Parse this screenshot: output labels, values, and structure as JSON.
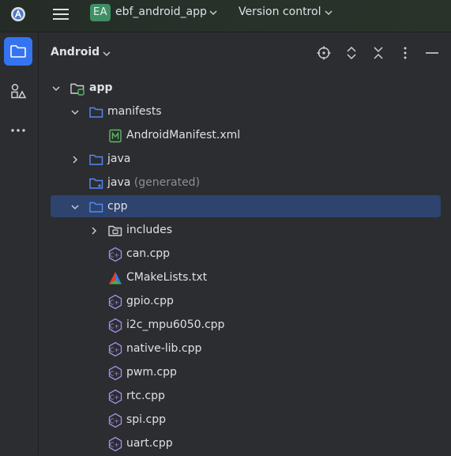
{
  "topbar": {
    "project_initials": "EA",
    "project_name": "ebf_android_app",
    "vcs_label": "Version control",
    "brand_color": "#3f8f64"
  },
  "sidebar": {
    "items": [
      {
        "icon": "folder-icon",
        "active": true
      },
      {
        "icon": "shapes-icon",
        "active": false
      },
      {
        "icon": "more-icon",
        "active": false
      }
    ],
    "active_color": "#3574f0"
  },
  "panel": {
    "title": "Android",
    "actions": [
      "locate-icon",
      "expand-all-icon",
      "collapse-all-icon",
      "options-icon",
      "minimize-icon"
    ]
  },
  "tree": {
    "selection_color": "#2e436e",
    "nodes": [
      {
        "label": "app",
        "depth": 0,
        "arrow": "down",
        "icon": "module-folder",
        "bold": true
      },
      {
        "label": "manifests",
        "depth": 1,
        "arrow": "down",
        "icon": "folder"
      },
      {
        "label": "AndroidManifest.xml",
        "depth": 2,
        "arrow": "none",
        "icon": "manifest-file"
      },
      {
        "label": "java",
        "depth": 1,
        "arrow": "right",
        "icon": "folder"
      },
      {
        "label": "java",
        "suffix": "(generated)",
        "depth": 1,
        "arrow": "none",
        "icon": "generated-folder"
      },
      {
        "label": "cpp",
        "depth": 1,
        "arrow": "down",
        "icon": "folder",
        "selected": true
      },
      {
        "label": "includes",
        "depth": 2,
        "arrow": "right",
        "icon": "include-folder"
      },
      {
        "label": "can.cpp",
        "depth": 2,
        "arrow": "none",
        "icon": "cpp-file"
      },
      {
        "label": "CMakeLists.txt",
        "depth": 2,
        "arrow": "none",
        "icon": "cmake-file"
      },
      {
        "label": "gpio.cpp",
        "depth": 2,
        "arrow": "none",
        "icon": "cpp-file"
      },
      {
        "label": "i2c_mpu6050.cpp",
        "depth": 2,
        "arrow": "none",
        "icon": "cpp-file"
      },
      {
        "label": "native-lib.cpp",
        "depth": 2,
        "arrow": "none",
        "icon": "cpp-file"
      },
      {
        "label": "pwm.cpp",
        "depth": 2,
        "arrow": "none",
        "icon": "cpp-file"
      },
      {
        "label": "rtc.cpp",
        "depth": 2,
        "arrow": "none",
        "icon": "cpp-file"
      },
      {
        "label": "spi.cpp",
        "depth": 2,
        "arrow": "none",
        "icon": "cpp-file"
      },
      {
        "label": "uart.cpp",
        "depth": 2,
        "arrow": "none",
        "icon": "cpp-file"
      }
    ]
  }
}
